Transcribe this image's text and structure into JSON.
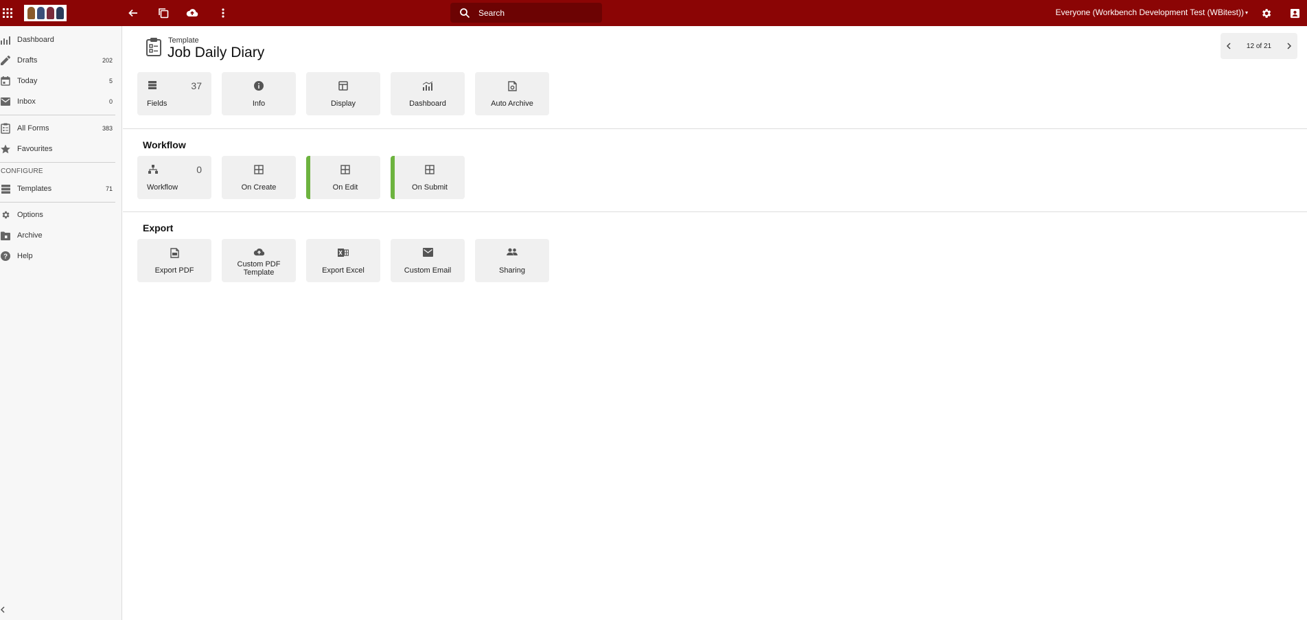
{
  "topbar": {
    "search_label": "Search",
    "user_label": "Everyone (Workbench Development Test (WBitest))",
    "accent": "#8b0505"
  },
  "sidebar": {
    "items": [
      {
        "label": "Dashboard",
        "count": "",
        "icon": "chart-icon"
      },
      {
        "label": "Drafts",
        "count": "202",
        "icon": "pencil-icon"
      },
      {
        "label": "Today",
        "count": "5",
        "icon": "calendar-icon"
      },
      {
        "label": "Inbox",
        "count": "0",
        "icon": "mail-icon"
      },
      {
        "label": "All Forms",
        "count": "383",
        "icon": "clipboard-icon"
      },
      {
        "label": "Favourites",
        "count": "",
        "icon": "star-icon"
      },
      {
        "label": "Templates",
        "count": "71",
        "icon": "list-icon"
      },
      {
        "label": "Options",
        "count": "",
        "icon": "gear-icon"
      },
      {
        "label": "Archive",
        "count": "",
        "icon": "archive-icon"
      },
      {
        "label": "Help",
        "count": "",
        "icon": "help-icon"
      }
    ],
    "configure_label": "CONFIGURE"
  },
  "header": {
    "subtitle": "Template",
    "title": "Job Daily Diary",
    "pager_text": "12 of 21"
  },
  "sections": {
    "top": {
      "cards": [
        {
          "label": "Fields",
          "count": "37"
        },
        {
          "label": "Info"
        },
        {
          "label": "Display"
        },
        {
          "label": "Dashboard"
        },
        {
          "label": "Auto Archive"
        }
      ]
    },
    "workflow": {
      "title": "Workflow",
      "cards": [
        {
          "label": "Workflow",
          "count": "0"
        },
        {
          "label": "On Create"
        },
        {
          "label": "On Edit"
        },
        {
          "label": "On Submit"
        }
      ]
    },
    "export": {
      "title": "Export",
      "cards": [
        {
          "label": "Export PDF"
        },
        {
          "label": "Custom PDF Template"
        },
        {
          "label": "Export Excel"
        },
        {
          "label": "Custom Email"
        },
        {
          "label": "Sharing"
        }
      ]
    }
  },
  "colors": {
    "active_indicator": "#6db33f",
    "card_bg": "#f0f0f0"
  }
}
